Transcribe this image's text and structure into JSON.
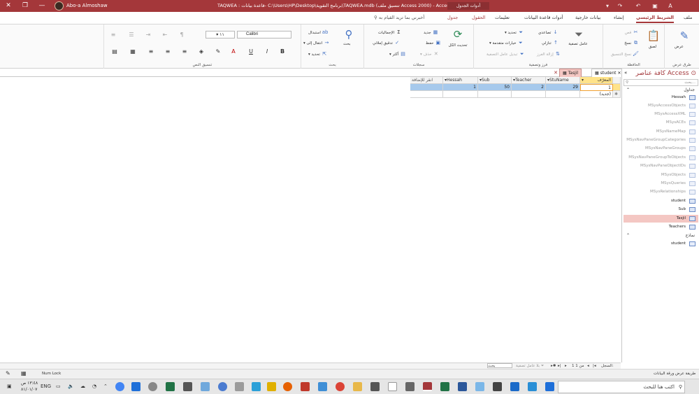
{
  "titlebar": {
    "window_title": "TAQWEA : قاعدة بيانات- C:\\Users\\HP\\Desktop\\برنامج التقوية\\TAQWEA.mdb (تنسيق ملف Access 2000) - Access",
    "context_label": "أدوات الجدول",
    "user_name": "Abo-a Almoshaw"
  },
  "tabs": {
    "file": "ملف",
    "home": "الشريط الرئيسي",
    "create": "إنشاء",
    "external": "بيانات خارجية",
    "dbtools": "أدوات قاعدة البيانات",
    "help": "تعليمات",
    "fields": "الحقول",
    "table": "جدول",
    "tellme": "أخبرني بما تريد القيام به"
  },
  "ribbon": {
    "views_group": "طرق عرض",
    "view_btn": "عرض",
    "clipboard_group": "الحافظة",
    "paste_btn": "لصق",
    "cut_btn": "قص",
    "copy_btn": "نسخ",
    "format_painter_btn": "نسخ التنسيق",
    "sort_group": "فرز وتصفية",
    "filter_btn": "عامل تصفية",
    "ascending_btn": "تصاعدي",
    "descending_btn": "تنازلي",
    "remove_sort_btn": "إزالة الفرز",
    "selection_btn": "تحديد",
    "advanced_btn": "خيارات متقدمة",
    "toggle_filter_btn": "تبديل عامل التصفية",
    "records_group": "سجلات",
    "refresh_btn": "تحديث الكل",
    "new_btn": "جديد",
    "save_btn": "حفظ",
    "delete_btn": "حذف",
    "totals_btn": "الإجماليات",
    "spelling_btn": "تدقيق إملائي",
    "more_btn": "أكثر",
    "find_group": "بحث",
    "find_btn": "بحث",
    "replace_btn": "استبدال",
    "goto_btn": "انتقال إلى",
    "select_btn": "تحديد",
    "text_format_group": "تنسيق النص",
    "font_name": "Calibri",
    "font_size": "١١"
  },
  "doc_tabs": {
    "student": "student",
    "tasjil": "Tasjil"
  },
  "datasheet": {
    "columns": [
      "المعرّف",
      "StuName",
      "Teacher",
      "Sub",
      "Hessah",
      "انقر للإضافة"
    ],
    "row": [
      "1",
      "29",
      "2",
      "50",
      "1",
      ""
    ],
    "new_label": "(جديد)"
  },
  "nav": {
    "title": "كافة عناصر Access",
    "search_placeholder": "بحث...",
    "tables_group": "جداول",
    "tables": [
      "Hessah",
      "MSysAccessObjects",
      "MSysAccessXML",
      "MSysACEs",
      "MSysNameMap",
      "MSysNavPaneGroupCategories",
      "MSysNavPaneGroups",
      "MSysNavPaneGroupToObjects",
      "MSysNavPaneObjectIDs",
      "MSysObjects",
      "MSysQueries",
      "MSysRelationships",
      "student",
      "Sub",
      "Tasjil",
      "Teachers"
    ],
    "forms_group": "نماذج",
    "forms": [
      "student"
    ]
  },
  "recnav": {
    "record_label": "السجل:",
    "position": "1 من 1",
    "no_filter": "بلا عامل تصفية",
    "search": "بحث"
  },
  "status": {
    "view_text": "طريقة عرض ورقة البيانات",
    "num_lock": "Num Lock"
  },
  "taskbar": {
    "search_placeholder": "اكتب هنا للبحث",
    "lang": "ENG",
    "time": "١٣:٤٨ ص",
    "date": "٨١/٠١/٠٧"
  }
}
